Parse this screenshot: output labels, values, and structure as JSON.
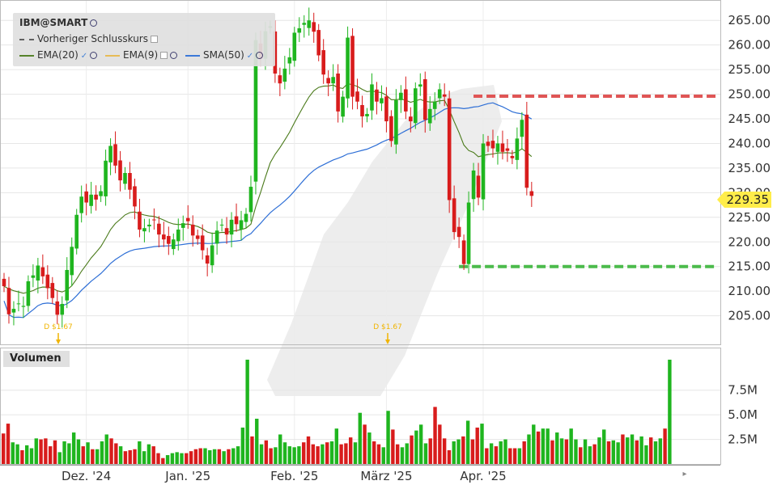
{
  "legend": {
    "symbol": "IBM@SMART",
    "prev_close": "Vorheriger Schlusskurs",
    "ema20": "EMA(20)",
    "ema9": "EMA(9)",
    "sma50": "SMA(50)"
  },
  "volume_label": "Volumen",
  "last_price": "229.35",
  "dividend_markers": [
    {
      "label": "D $1.67",
      "date": "2024-11-08"
    },
    {
      "label": "D $1.67",
      "date": "2025-02-10"
    }
  ],
  "colors": {
    "up": "#1fb51f",
    "down": "#d81c1c",
    "ema20": "#4a7a1a",
    "ema9": "#e6b84a",
    "sma50": "#2e6fd6",
    "resistance": "#e05555",
    "support": "#4cbb4c",
    "last_price_bg": "#ffed4a",
    "dividend": "#f0b400"
  },
  "chart_data": {
    "type": "candlestick",
    "price_axis": {
      "ticks": [
        "265.00",
        "260.00",
        "255.00",
        "250.00",
        "245.00",
        "240.00",
        "235.00",
        "230.00",
        "225.00",
        "220.00",
        "215.00",
        "210.00",
        "205.00"
      ],
      "ylim": [
        200.5,
        267.5
      ]
    },
    "volume_axis": {
      "ticks": [
        "7.5M",
        "5.0M",
        "2.5M"
      ],
      "ylim": [
        0,
        11.5
      ]
    },
    "x_labels": [
      {
        "label": "Dez. '24",
        "index": 17
      },
      {
        "label": "Jan. '25",
        "index": 38
      },
      {
        "label": "Feb. '25",
        "index": 60
      },
      {
        "label": "März '25",
        "index": 79
      },
      {
        "label": "Apr. '25",
        "index": 99
      }
    ],
    "resistance_level": 249.6,
    "support_level": 215.0,
    "closes": [
      211.0,
      205.3,
      206.4,
      207.5,
      207.0,
      212.0,
      213.2,
      215.2,
      213.0,
      210.6,
      208.6,
      205.2,
      207.4,
      214.3,
      219.0,
      225.5,
      229.2,
      228.0,
      229.6,
      228.6,
      230.3,
      236.5,
      239.5,
      235.5,
      232.5,
      234.0,
      230.6,
      227.2,
      222.5,
      222.8,
      223.5,
      224.4,
      221.5,
      220.5,
      219.6,
      220.5,
      222.5,
      223.8,
      224.2,
      221.3,
      220.6,
      218.3,
      215.6,
      219.3,
      222.3,
      223.5,
      221.5,
      224.5,
      223.6,
      224.4,
      225.7,
      231.2,
      261.0,
      257.2,
      262.8,
      263.8,
      254.2,
      252.2,
      255.2,
      257.5,
      262.5,
      263.4,
      264.5,
      265.0,
      262.7,
      257.9,
      254.0,
      252.2,
      253.5,
      246.5,
      249.5,
      261.5,
      249.5,
      248.5,
      245.5,
      246.0,
      252.0,
      248.5,
      249.2,
      244.5,
      240.5,
      248.8,
      250.3,
      246.5,
      244.5,
      251.2,
      252.0,
      244.8,
      247.0,
      248.5,
      251.0,
      249.5,
      228.5,
      222.0,
      221.0,
      215.5,
      228.0,
      234.5,
      229.0,
      240.0,
      239.5,
      239.0,
      240.0,
      238.3,
      238.5,
      237.0,
      241.0,
      244.8,
      231.0,
      229.35
    ],
    "volume_millions": [
      3.1,
      4.1,
      2.2,
      2.0,
      1.4,
      1.9,
      1.6,
      2.6,
      2.5,
      2.6,
      1.8,
      2.4,
      1.2,
      2.3,
      2.1,
      3.2,
      2.5,
      1.8,
      2.2,
      1.5,
      1.5,
      2.3,
      3.0,
      2.6,
      2.1,
      1.8,
      1.3,
      1.4,
      1.5,
      2.3,
      1.3,
      2.0,
      1.8,
      1.1,
      0.6,
      0.9,
      1.1,
      1.2,
      1.1,
      1.1,
      1.3,
      1.5,
      1.6,
      1.6,
      1.4,
      1.5,
      1.5,
      1.3,
      1.5,
      1.6,
      1.8,
      3.7,
      10.6,
      2.8,
      4.6,
      2.0,
      2.4,
      1.6,
      1.7,
      3.0,
      2.2,
      1.8,
      1.7,
      1.8,
      2.2,
      2.8,
      2.0,
      1.8,
      2.0,
      2.2,
      2.3,
      3.6,
      2.0,
      2.1,
      2.7,
      2.2,
      5.2,
      4.0,
      3.2,
      2.3,
      2.0,
      1.7,
      5.4,
      3.5,
      2.0,
      1.7,
      2.1,
      2.9,
      3.4,
      4.0,
      2.1,
      2.6,
      5.8,
      4.0,
      2.6,
      1.4,
      2.3,
      2.5,
      2.8,
      4.4,
      2.5,
      3.7,
      4.1,
      1.6,
      2.1,
      1.8,
      2.3,
      2.5,
      1.6,
      1.6,
      1.6,
      2.3,
      3.0,
      4.0,
      3.3,
      3.6,
      3.6,
      2.4,
      3.2,
      2.6,
      2.5,
      3.6,
      2.5,
      1.7,
      2.5,
      1.8,
      2.0,
      2.7,
      3.5,
      2.3,
      2.4,
      2.2,
      3.0,
      2.7,
      3.0,
      2.4,
      2.8,
      1.9,
      2.7,
      2.3,
      2.6,
      3.6,
      10.6
    ]
  }
}
